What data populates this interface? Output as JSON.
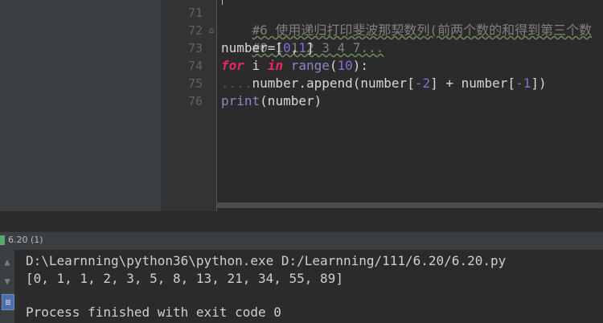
{
  "editor": {
    "line_numbers": [
      "71",
      "72",
      "73",
      "74",
      "75",
      "76"
    ],
    "lines": {
      "l71": "#6 使用递归打印斐波那契数列(前两个数的和得到第三个数",
      "l72": "#0 1 1 2 3 4 7...",
      "l73a": "number=[",
      "l73b": "0",
      "l73c": ",",
      "l73d": "1",
      "l73e": "]",
      "l74a": "for",
      "l74b": " i ",
      "l74c": "in",
      "l74d": " ",
      "l74e": "range",
      "l74f": "(",
      "l74g": "10",
      "l74h": "):",
      "l75a": "....",
      "l75b": "number.append(number[",
      "l75c": "-2",
      "l75d": "] + number[",
      "l75e": "-1",
      "l75f": "])",
      "l76a": "print",
      "l76b": "(number)"
    }
  },
  "run_panel": {
    "title": "6.20 (1)",
    "console": [
      "D:\\Learnning\\python36\\python.exe D:/Learnning/111/6.20/6.20.py",
      "[0, 1, 1, 2, 3, 5, 8, 13, 21, 34, 55, 89]",
      "",
      "Process finished with exit code 0"
    ],
    "toolbar_icons": [
      "arrow-up-icon",
      "arrow-down-icon",
      "soft-wrap-icon"
    ]
  }
}
